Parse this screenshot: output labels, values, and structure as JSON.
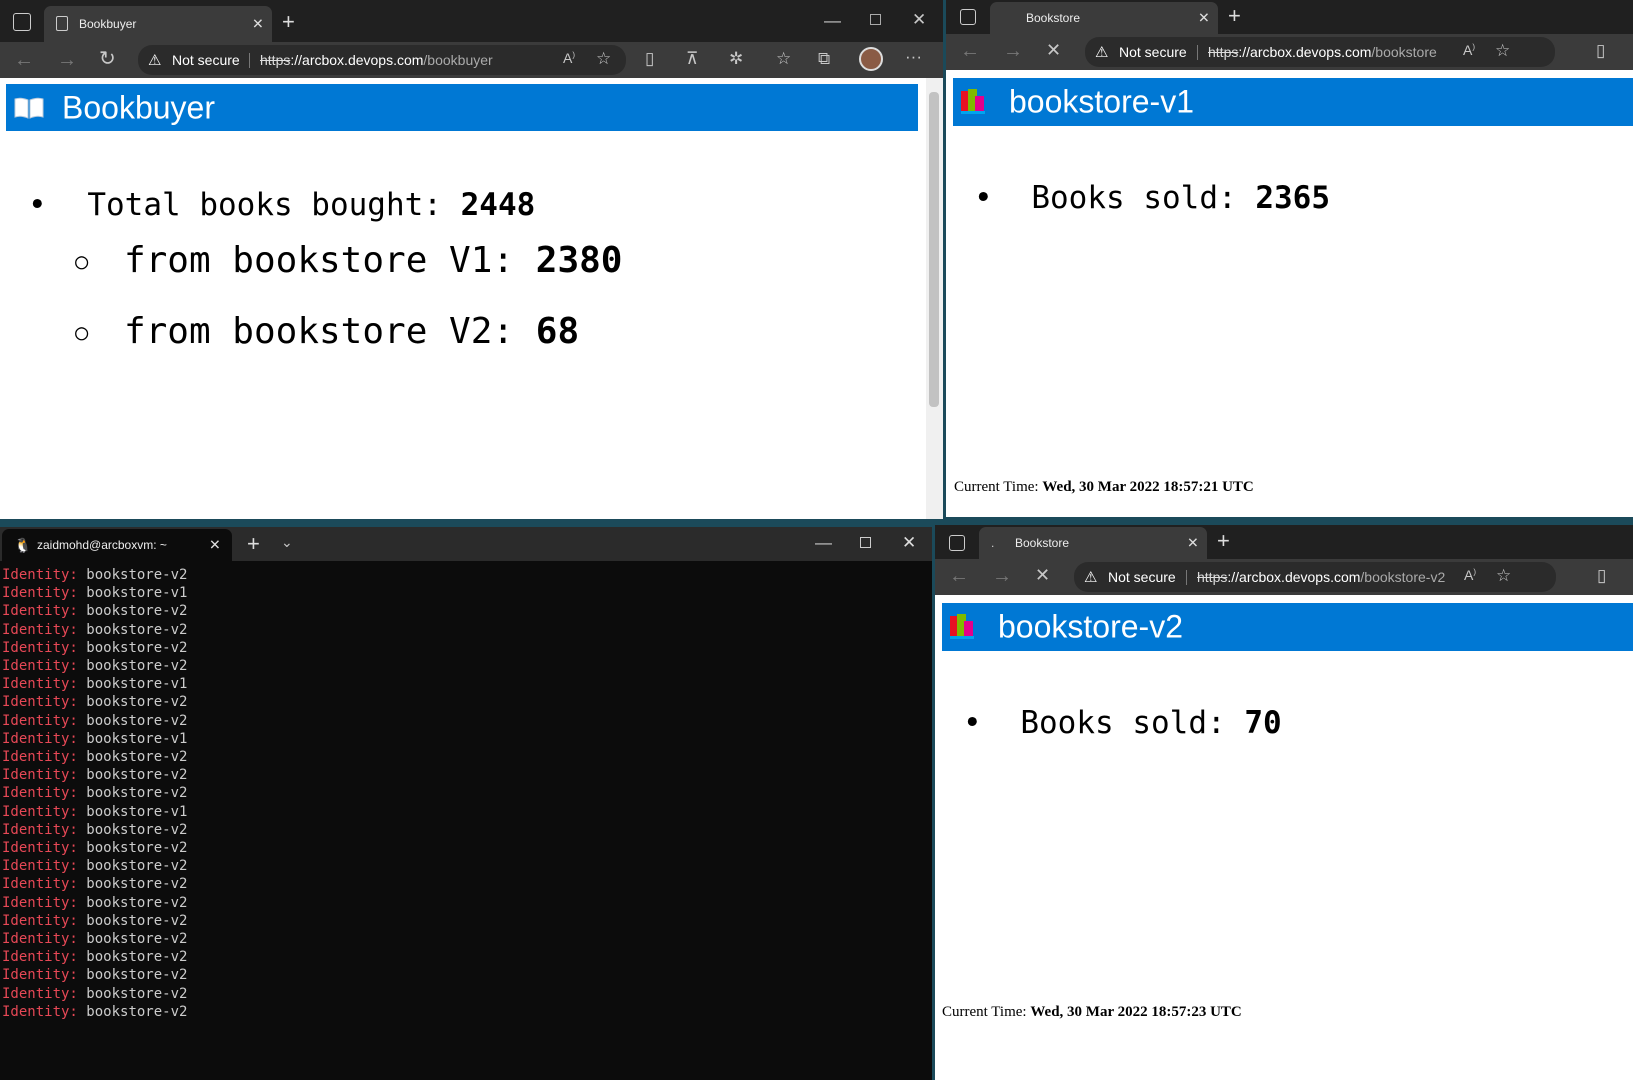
{
  "bookbuyer_window": {
    "tab_title": "Bookbuyer",
    "not_secure": "Not secure",
    "url_scheme": "https",
    "url_host": "://arcbox.devops.com",
    "url_path": "/bookbuyer",
    "header_title": "Bookbuyer",
    "total_label": "Total books bought:",
    "total_value": "2448",
    "v1_label": "from bookstore V1:",
    "v1_value": "2380",
    "v2_label": "from bookstore V2:",
    "v2_value": "68"
  },
  "bookstore_v1_window": {
    "tab_title": "Bookstore",
    "not_secure": "Not secure",
    "url_scheme": "https",
    "url_host": "://arcbox.devops.com",
    "url_path": "/bookstore",
    "header_title": "bookstore-v1",
    "sold_label": "Books sold:",
    "sold_value": "2365",
    "time_label": "Current Time:",
    "time_value": "Wed, 30 Mar 2022 18:57:21 UTC"
  },
  "bookstore_v2_window": {
    "tab_title": "Bookstore",
    "not_secure": "Not secure",
    "url_scheme": "https",
    "url_host": "://arcbox.devops.com",
    "url_path": "/bookstore-v2",
    "header_title": "bookstore-v2",
    "sold_label": "Books sold:",
    "sold_value": "70",
    "time_label": "Current Time:",
    "time_value": "Wed, 30 Mar 2022 18:57:23 UTC"
  },
  "terminal": {
    "tab_title": "zaidmohd@arcboxvm: ~",
    "key": "Identity:",
    "lines": [
      "bookstore-v2",
      "bookstore-v1",
      "bookstore-v2",
      "bookstore-v2",
      "bookstore-v2",
      "bookstore-v2",
      "bookstore-v1",
      "bookstore-v2",
      "bookstore-v2",
      "bookstore-v1",
      "bookstore-v2",
      "bookstore-v2",
      "bookstore-v2",
      "bookstore-v1",
      "bookstore-v2",
      "bookstore-v2",
      "bookstore-v2",
      "bookstore-v2",
      "bookstore-v2",
      "bookstore-v2",
      "bookstore-v2",
      "bookstore-v2",
      "bookstore-v2",
      "bookstore-v2",
      "bookstore-v2"
    ]
  },
  "colors": {
    "header_blue": "#0078d4",
    "identity_red": "#e74856",
    "browser_chrome": "#3b3b3b"
  }
}
